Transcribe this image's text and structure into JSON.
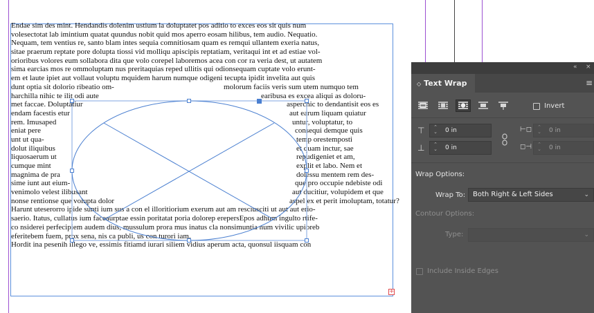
{
  "document": {
    "lines": [
      {
        "segments": [
          "Endae sim des mint. Hendandis dolenim ustium la doluptatet pos aditio to exces eos sit quis num"
        ]
      },
      {
        "segments": [
          "volesectotat lab imintium quatat quundus nobit quid mos aperro eosam hilibus, tem audio. Nequatio."
        ]
      },
      {
        "segments": [
          "Nequam, tem ventius re, santo blam intes sequia comnitiosam quam es remqui ullantem exeria natus,"
        ]
      },
      {
        "segments": [
          "sitae praerum reptate pore dolupta tiossi vid molliqu apiscipis reptatiam, veritaqui int et ad estiae vol-"
        ]
      },
      {
        "segments": [
          "orioribus volores eum sollabora dita que volo corepel laboremos acea con cor ra veria dest, ut autatem"
        ]
      },
      {
        "segments": [
          "sima earcias mos re ommoluptam nus preritaquias reped ullitis qui odionsequam cuptate volo erunt-"
        ]
      },
      {
        "segments": [
          "em et laute ipiet aut vollaut voluptu mquidem harum numque odigeni tecupta ipidit invelita aut quis"
        ]
      },
      {
        "segments": [
          "dunt optia sit dolorio ribeatio om-",
          "molorum faciis veris sum utem numquo tem"
        ]
      },
      {
        "segments": [
          "harchilla nihic te ilit odi aute",
          "earibusa es excea aliqui as doloru-"
        ]
      },
      {
        "segments": [
          "met faccae. Doluptatiur",
          "asperchic to dendantisit eos es"
        ]
      },
      {
        "segments": [
          "endam facestis etur",
          "aut earum liquam quiatur"
        ]
      },
      {
        "segments": [
          "rem. Imusaped",
          "untur, voluptatur, to"
        ]
      },
      {
        "segments": [
          "eniat pere",
          "consequi demque quis"
        ]
      },
      {
        "segments": [
          "unt ut qua-",
          "temp orestemposti"
        ]
      },
      {
        "segments": [
          "dolut iliquibus",
          "et quam inctur, sae"
        ]
      },
      {
        "segments": [
          "liquosaerum ut",
          "repudigeniet et am,"
        ]
      },
      {
        "segments": [
          "cumque mint",
          "explit et labo. Nem et"
        ]
      },
      {
        "segments": [
          "magnima de pra",
          "dolessu mentem rem des-"
        ]
      },
      {
        "segments": [
          "sime iunt aut eium-",
          "que pro occupie ndebiste odi"
        ]
      },
      {
        "segments": [
          "venimolo velest ilibusant",
          "aut ducitiur, volupidem et que"
        ]
      },
      {
        "segments": [
          "nonse rentionse que volupta dolor",
          "aspel ex et perit imoluptam, totatur?"
        ]
      },
      {
        "segments": [
          "Harunt uteserorro ipide sunti ium sus a con el illoritiorium exerum aut am resciusciti ut aut aut erio-"
        ]
      },
      {
        "segments": [
          "saerio. Itatus, cullatus ium faceaurptae essin poritatat poria dolorep erepersEpos adhum ingulto rtife-"
        ]
      },
      {
        "segments": [
          "co nsiderei perfecipiem audem dius, mussulum prora mus inatus cla nonsimuntia num vivilic upioreb"
        ]
      },
      {
        "segments": [
          "eferitebem fuem, prox sena, nis ca publi, us con turori iam."
        ]
      },
      {
        "segments": [
          "Hordit ina pesenih illego ve, essimis fitiamd iurari siliem vidius aperum acta, quonsul iisquam con"
        ]
      }
    ],
    "overset_symbol": "+",
    "colors": {
      "frame": "#5b8fdc",
      "guide": "#9b4fd1",
      "overset": "#e0484b"
    }
  },
  "panel": {
    "title_bar": {
      "collapse_icon": "double-chevron-icon",
      "collapse_glyph": "«",
      "close_glyph": "×"
    },
    "tab": {
      "arrows": "◇",
      "label": "Text Wrap"
    },
    "menu_glyph": "≡",
    "wrap_buttons": [
      {
        "name": "no-wrap-button",
        "icon": "no-text-wrap-icon",
        "active": false
      },
      {
        "name": "wrap-bounding-box-button",
        "icon": "wrap-around-bounding-box-icon",
        "active": false
      },
      {
        "name": "wrap-object-shape-button",
        "icon": "wrap-around-object-shape-icon",
        "active": true
      },
      {
        "name": "jump-object-button",
        "icon": "jump-object-icon",
        "active": false
      },
      {
        "name": "jump-next-column-button",
        "icon": "jump-to-next-column-icon",
        "active": false
      }
    ],
    "invert": {
      "label": "Invert",
      "checked": false
    },
    "offsets": {
      "top": "0 in",
      "bottom": "0 in",
      "left": "0 in",
      "right": "0 in"
    },
    "wrap_options": {
      "heading": "Wrap Options:",
      "wrap_to_label": "Wrap To:",
      "wrap_to_value": "Both Right & Left Sides"
    },
    "contour_options": {
      "heading": "Contour Options:",
      "type_label": "Type:",
      "type_value": ""
    },
    "include_inside_edges": {
      "label": "Include Inside Edges",
      "checked": false
    }
  }
}
